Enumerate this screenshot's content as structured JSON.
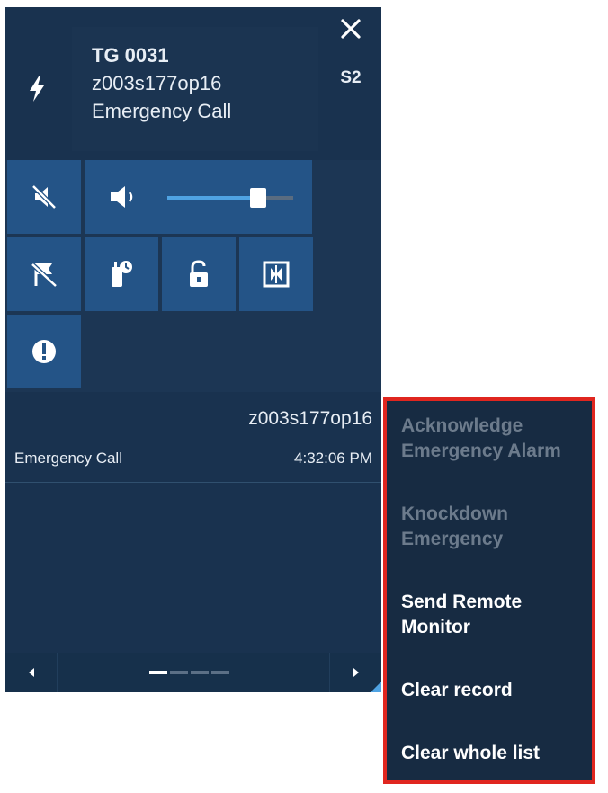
{
  "header": {
    "talkgroup": "TG 0031",
    "unit_id": "z003s177op16",
    "call_type": "Emergency Call",
    "site": "S2",
    "close_icon": "close-icon",
    "type_icon": "lightning-icon"
  },
  "controls": {
    "mute_icon": "speaker-muted-icon",
    "volume_icon": "speaker-icon",
    "volume_level_percent": 72,
    "buttons": [
      "flag-off-icon",
      "remote-monitor-icon",
      "unlock-icon",
      "patch-icon",
      "alert-icon"
    ]
  },
  "record": {
    "unit_id": "z003s177op16",
    "type": "Emergency Call",
    "time": "4:32:06 PM"
  },
  "pager": {
    "pages": 4,
    "current": 1
  },
  "context_menu": {
    "items": [
      {
        "label": "Acknowledge Emergency Alarm",
        "enabled": false
      },
      {
        "label": "Knockdown Emergency",
        "enabled": false
      },
      {
        "label": "Send Remote Monitor",
        "enabled": true
      },
      {
        "label": "Clear record",
        "enabled": true
      },
      {
        "label": "Clear whole list",
        "enabled": true
      }
    ]
  },
  "colors": {
    "panel_bg": "#1c3654",
    "tile_bg": "#245487",
    "accent": "#4fa3e3",
    "highlight_border": "#e0261f"
  }
}
